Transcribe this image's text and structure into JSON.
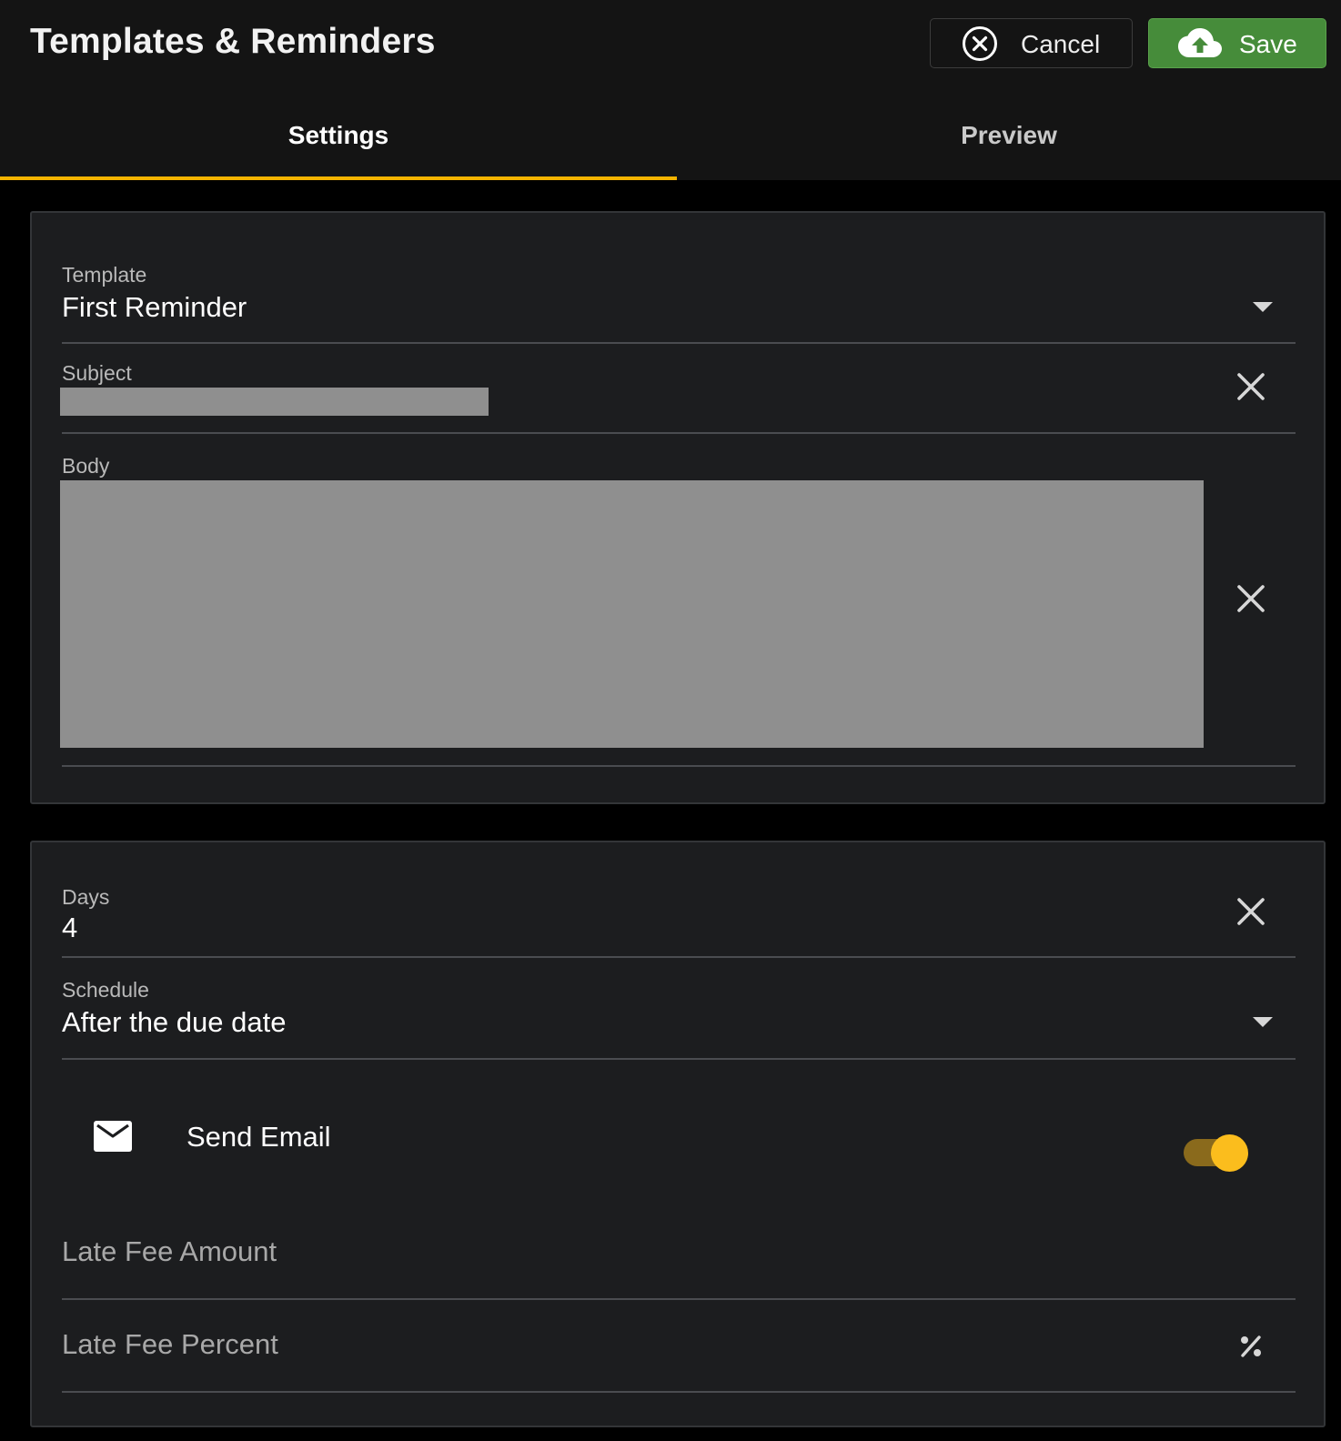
{
  "header": {
    "title": "Templates & Reminders",
    "cancel_label": "Cancel",
    "save_label": "Save"
  },
  "tabs": [
    {
      "label": "Settings",
      "active": true
    },
    {
      "label": "Preview",
      "active": false
    }
  ],
  "template_card": {
    "template": {
      "label": "Template",
      "value": "First Reminder"
    },
    "subject": {
      "label": "Subject",
      "value": ""
    },
    "body": {
      "label": "Body",
      "value": ""
    }
  },
  "reminder_card": {
    "days": {
      "label": "Days",
      "value": "4"
    },
    "schedule": {
      "label": "Schedule",
      "value": "After the due date"
    },
    "send_email": {
      "label": "Send Email",
      "enabled": true
    },
    "late_fee_amount": {
      "placeholder": "Late Fee Amount"
    },
    "late_fee_percent": {
      "placeholder": "Late Fee Percent"
    }
  },
  "colors": {
    "accent": "#f5b400",
    "save_green": "#468c3a",
    "toggle_on": "#fbbd1d",
    "card_bg": "#1c1d1f"
  },
  "icons": {
    "cancel": "x-circle-icon",
    "save": "cloud-upload-icon",
    "clear": "close-icon",
    "dropdown": "caret-down-icon",
    "email": "mail-icon",
    "percent": "percent-icon"
  }
}
